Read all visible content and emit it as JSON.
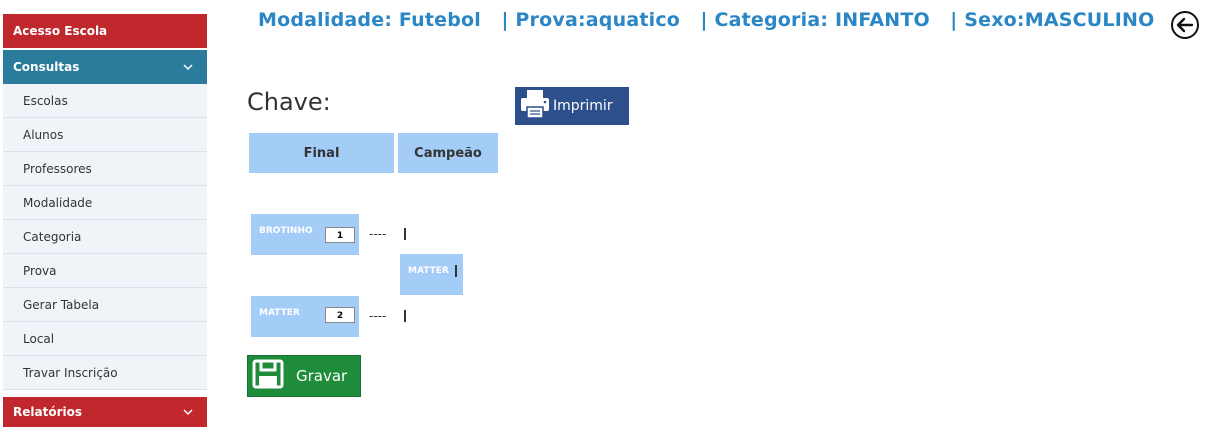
{
  "sidebar": {
    "access_label": "Acesso Escola",
    "consultas_label": "Consultas",
    "items": [
      {
        "label": "Escolas"
      },
      {
        "label": "Alunos"
      },
      {
        "label": "Professores"
      },
      {
        "label": "Modalidade"
      },
      {
        "label": "Categoria"
      },
      {
        "label": "Prova"
      },
      {
        "label": "Gerar Tabela"
      },
      {
        "label": "Local"
      },
      {
        "label": "Travar Inscrição"
      }
    ],
    "relatorios_label": "Relatórios",
    "chevron_icon": "chevron-down-icon"
  },
  "header": {
    "title": "Modalidade: Futebol   | Prova:aquatico   | Categoria: INFANTO   | Sexo:MASCULINO",
    "back_icon": "arrow-left-circle-icon"
  },
  "main": {
    "chave_label": "Chave:",
    "print_label": "Imprimir",
    "columns": [
      "Final",
      "Campeão"
    ],
    "matches": [
      {
        "team": "BROTINHO",
        "score": "1",
        "separator": "----"
      },
      {
        "team": "MATTER",
        "score": "2",
        "separator": "----"
      }
    ],
    "winner": "MATTER",
    "save_label": "Gravar"
  },
  "colors": {
    "red": "#c0282e",
    "teal": "#2a7b9c",
    "title_blue": "#2a86c5",
    "cell_blue": "#a3ccf7",
    "print_blue": "#2d4f8c",
    "save_green": "#1e8c3a"
  }
}
